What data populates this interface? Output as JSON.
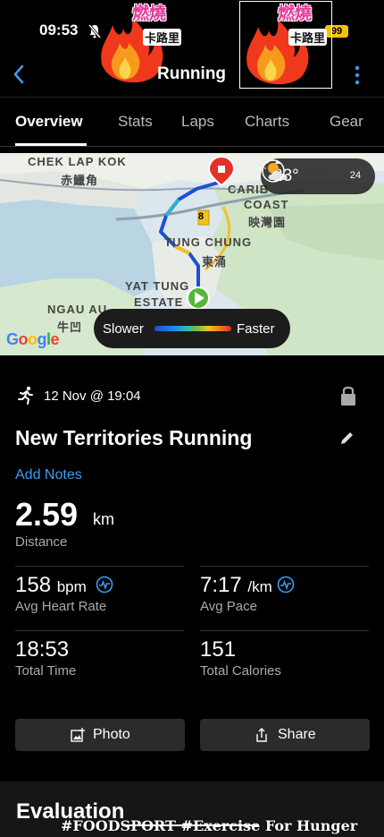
{
  "status_bar": {
    "time": "09:53",
    "battery": "99"
  },
  "stickers": [
    {
      "main": "燃燒",
      "sub": "卡路里"
    },
    {
      "main": "燃燒",
      "sub": "卡路里"
    }
  ],
  "nav": {
    "title": "Running"
  },
  "tabs": [
    "Overview",
    "Stats",
    "Laps",
    "Charts",
    "Gear"
  ],
  "map": {
    "labels": [
      "CHEK LAP KOK",
      "赤鱲角",
      "CARIB",
      "COAST",
      "映灣園",
      "TUNG CHUNG",
      "東涌",
      "YAT TUNG",
      "ESTATE",
      "NGAU AU",
      "牛凹"
    ],
    "road_marker": "8",
    "weather": {
      "temp": "23°",
      "wind": "24"
    },
    "legend": {
      "slower": "Slower",
      "faster": "Faster"
    },
    "google": "Google"
  },
  "activity": {
    "date": "12 Nov @ 19:04",
    "title": "New Territories Running",
    "add_notes": "Add Notes",
    "distance": {
      "value": "2.59",
      "unit": "km",
      "label": "Distance"
    },
    "avg_heart_rate": {
      "value": "158",
      "unit": "bpm",
      "label": "Avg Heart Rate"
    },
    "avg_pace": {
      "value": "7:17",
      "unit": "/km",
      "label": "Avg Pace"
    },
    "total_time": {
      "value": "18:53",
      "label": "Total Time"
    },
    "total_calories": {
      "value": "151",
      "label": "Total Calories"
    }
  },
  "buttons": {
    "photo": "Photo",
    "share": "Share"
  },
  "evaluation": {
    "title": "Evaluation"
  },
  "watermark": "#FOODSPORT #Exercise For Hunger",
  "colors": {
    "accent": "#3e9bf0",
    "background": "#000000",
    "button": "#2b2b2b",
    "pin_red": "#e5312a",
    "start_green": "#55b63c"
  }
}
